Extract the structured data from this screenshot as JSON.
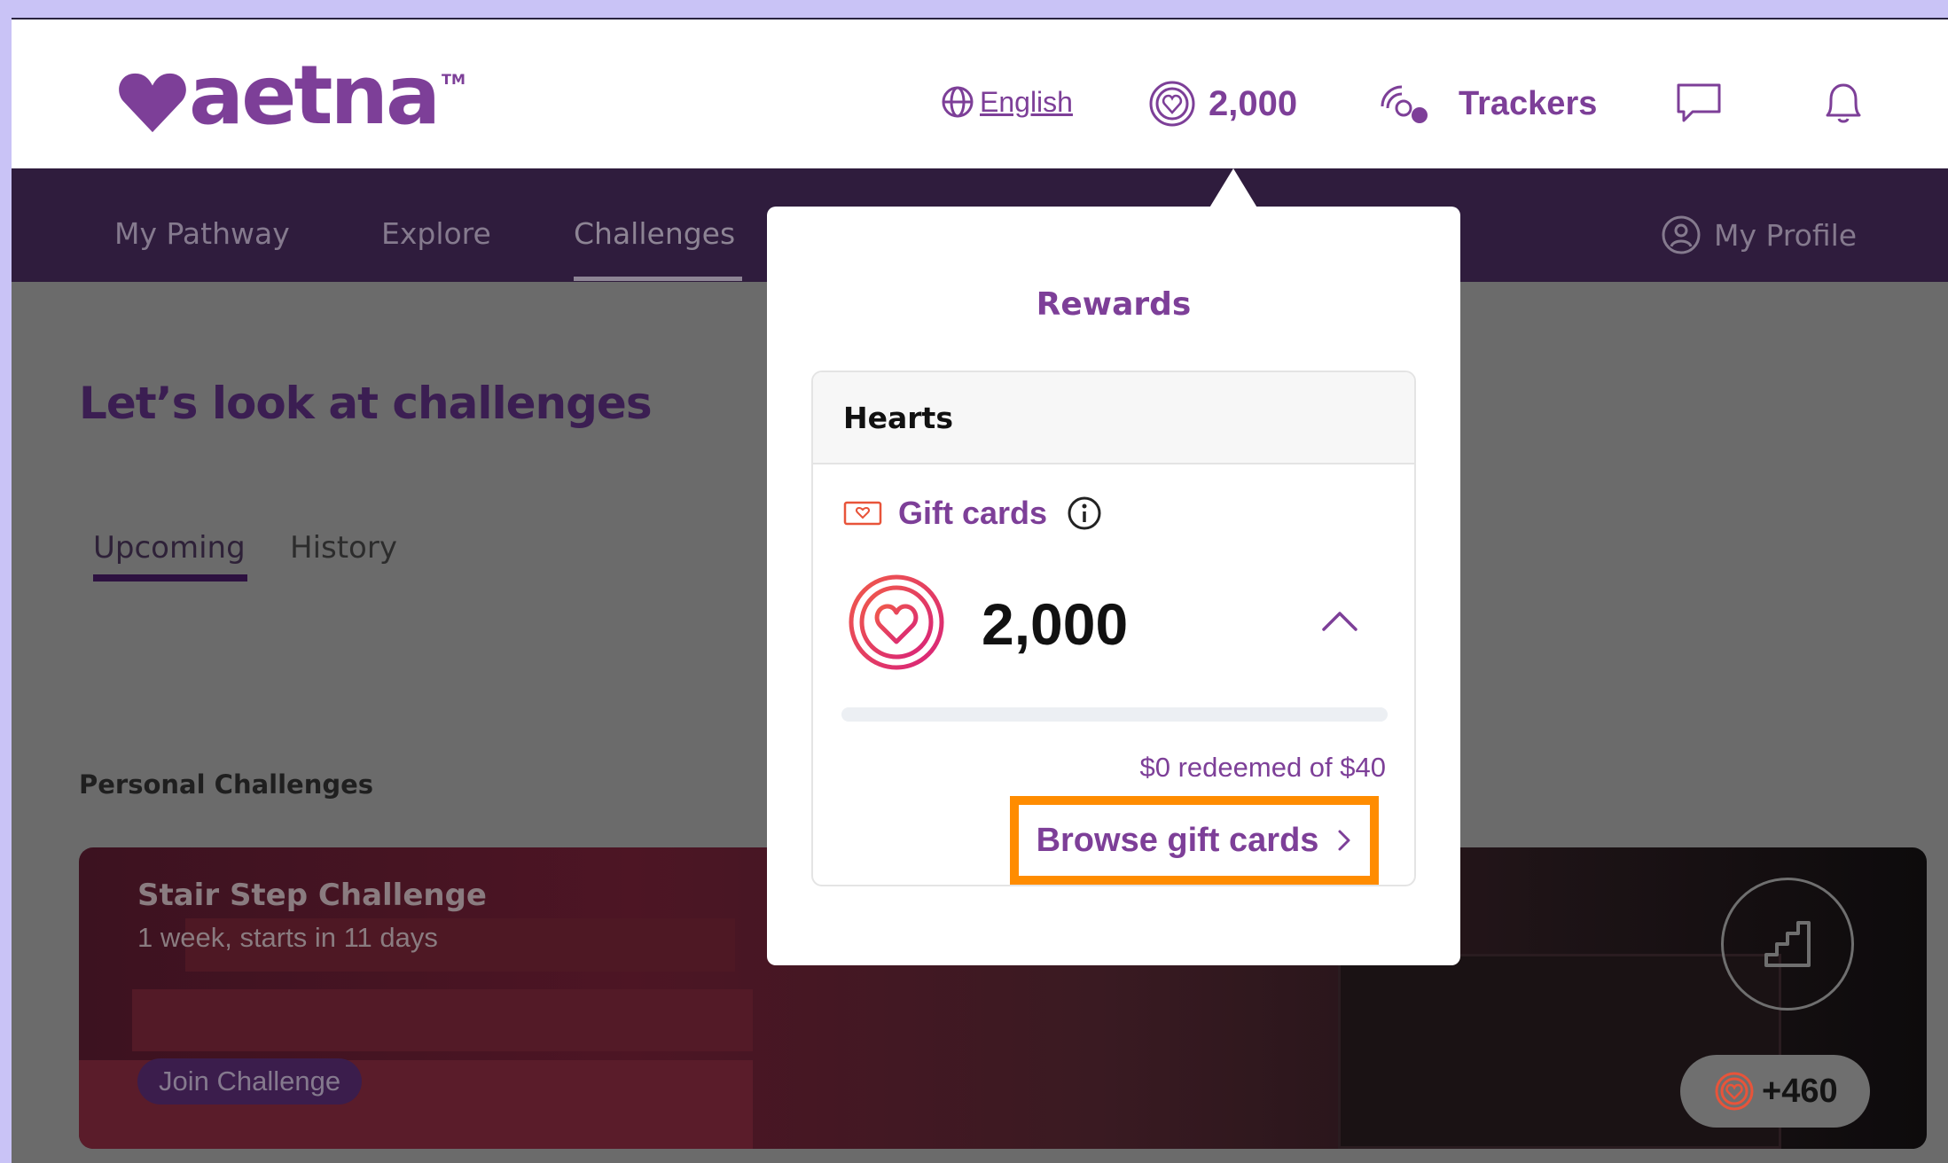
{
  "header": {
    "brand": "aetna",
    "trademark": "TM",
    "language": "English",
    "hearts_balance": "2,000",
    "trackers": "Trackers"
  },
  "nav": {
    "items": [
      "My Pathway",
      "Explore",
      "Challenges"
    ],
    "profile": "My Profile"
  },
  "content": {
    "title": "Let’s look at challenges",
    "tabs": [
      "Upcoming",
      "History"
    ],
    "section": "Personal Challenges",
    "card": {
      "title": "Stair Step Challenge",
      "subtitle": "1 week, starts in 11 days",
      "join": "Join Challenge",
      "reward": "+460"
    }
  },
  "rewards": {
    "title": "Rewards",
    "hearts_label": "Hearts",
    "gift_cards_label": "Gift cards",
    "balance": "2,000",
    "redeemed_text": "$0 redeemed of $40",
    "redeemed_amount": 0,
    "redeem_limit": 40,
    "browse_label": "Browse gift cards"
  },
  "colors": {
    "brand_purple": "#7d3f98",
    "nav_bg": "#2f1c3d",
    "highlight": "#ff8c00"
  }
}
